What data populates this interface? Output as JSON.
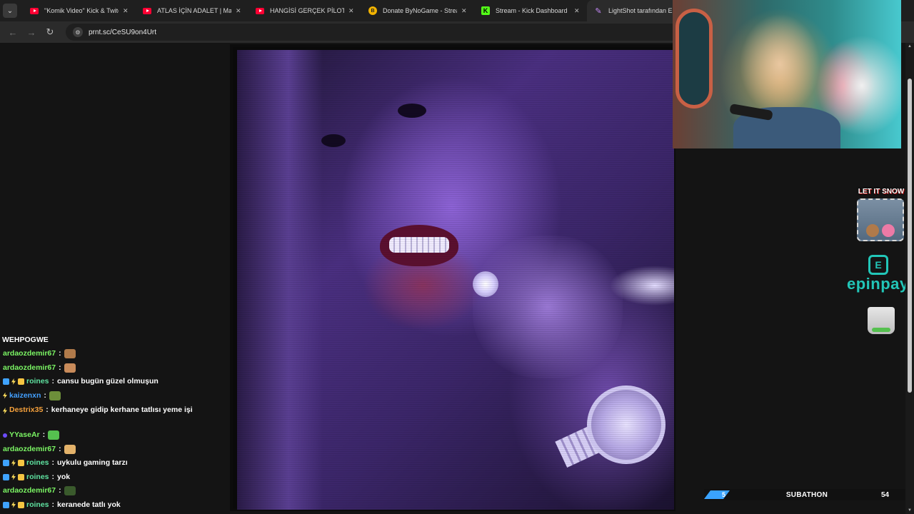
{
  "browser": {
    "tabs": [
      {
        "title": "\"Komik Video\" Kick & Twitch K",
        "icon": "youtube-icon"
      },
      {
        "title": "ATLAS İÇİN ADALET | Madara C",
        "icon": "youtube-icon"
      },
      {
        "title": "HANGİSİ GERÇEK PİLOT?! ft. @",
        "icon": "youtube-icon"
      },
      {
        "title": "Donate ByNoGame - Streamer",
        "icon": "donate-icon"
      },
      {
        "title": "Stream - Kick Dashboard",
        "icon": "kick-icon"
      },
      {
        "title": "LightShot tarafından Ekran G",
        "icon": "feather-icon"
      }
    ],
    "active_tab": 5,
    "url": "prnt.sc/CeSU9on4Urt"
  },
  "chat": {
    "header": "WEHPOGWE",
    "messages": [
      {
        "user": "ardaozdemir67",
        "color": "#7bf564",
        "badges": [],
        "text": "",
        "emote": "#b07a4a"
      },
      {
        "user": "ardaozdemir67",
        "color": "#7bf564",
        "badges": [],
        "text": "",
        "emote": "#c98b5a"
      },
      {
        "user": "roines",
        "color": "#5fe3a1",
        "badges": [
          "blue",
          "bolt",
          "gold"
        ],
        "text": "cansu bugün güzel olmuşun",
        "emote": ""
      },
      {
        "user": "kaizenxn",
        "color": "#43a0ff",
        "badges": [
          "bolt"
        ],
        "text": "",
        "emote": "#6d8f3a"
      },
      {
        "user": "Destrix35",
        "color": "#f7a23c",
        "badges": [
          "bolt"
        ],
        "text": "kerhaneye gidip kerhane tatlısı yeme işi",
        "emote": ""
      },
      {
        "user": "YYaseAr",
        "color": "#7bf564",
        "badges": [
          "purple"
        ],
        "text": "",
        "emote": "#55c04f"
      },
      {
        "user": "ardaozdemir67",
        "color": "#7bf564",
        "badges": [],
        "text": "",
        "emote": "#e3b26a"
      },
      {
        "user": "roines",
        "color": "#5fe3a1",
        "badges": [
          "blue",
          "bolt",
          "gold"
        ],
        "text": "uykulu gaming tarzı",
        "emote": ""
      },
      {
        "user": "roines",
        "color": "#5fe3a1",
        "badges": [
          "blue",
          "bolt",
          "gold"
        ],
        "text": "yok",
        "emote": ""
      },
      {
        "user": "ardaozdemir67",
        "color": "#7bf564",
        "badges": [],
        "text": "",
        "emote": "#3a5a2c"
      },
      {
        "user": "roines",
        "color": "#5fe3a1",
        "badges": [
          "blue",
          "bolt",
          "gold"
        ],
        "text": "keranede tatlı yok",
        "emote": ""
      }
    ]
  },
  "widgets": {
    "snow_title": "LET IT SNOW",
    "epin_text": "epinpay",
    "epin_icon": "E",
    "subathon_label": "SUBATHON",
    "subathon_left": "5",
    "subathon_right": "54"
  },
  "colors": {
    "accent_kick": "#53fc18",
    "epinpay": "#22c6b8",
    "subathon_flag": "#3aa3ff"
  }
}
